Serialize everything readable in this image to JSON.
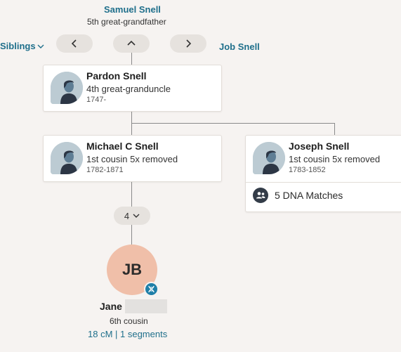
{
  "top": {
    "ancestor_name": "Samuel Snell",
    "ancestor_relation": "5th great-grandfather",
    "siblings_label": "Siblings",
    "next_name": "Job Snell"
  },
  "cards": {
    "pardon": {
      "name": "Pardon Snell",
      "relation": "4th great-granduncle",
      "dates": "1747-"
    },
    "michael": {
      "name": "Michael C Snell",
      "relation": "1st cousin 5x removed",
      "dates": "1782-1871"
    },
    "joseph": {
      "name": "Joseph Snell",
      "relation": "1st cousin 5x removed",
      "dates": "1783-1852",
      "dna_matches": "5 DNA Matches"
    }
  },
  "generations_pill": "4",
  "match": {
    "initials": "JB",
    "first_name": "Jane",
    "relation": "6th cousin",
    "shared_dna": "18 cM | 1 segments"
  },
  "colors": {
    "link": "#1f6f8b",
    "avatar_bg": "#bccbd3",
    "match_circle": "#f0bfa9",
    "dna_badge": "#1f7fa8"
  }
}
